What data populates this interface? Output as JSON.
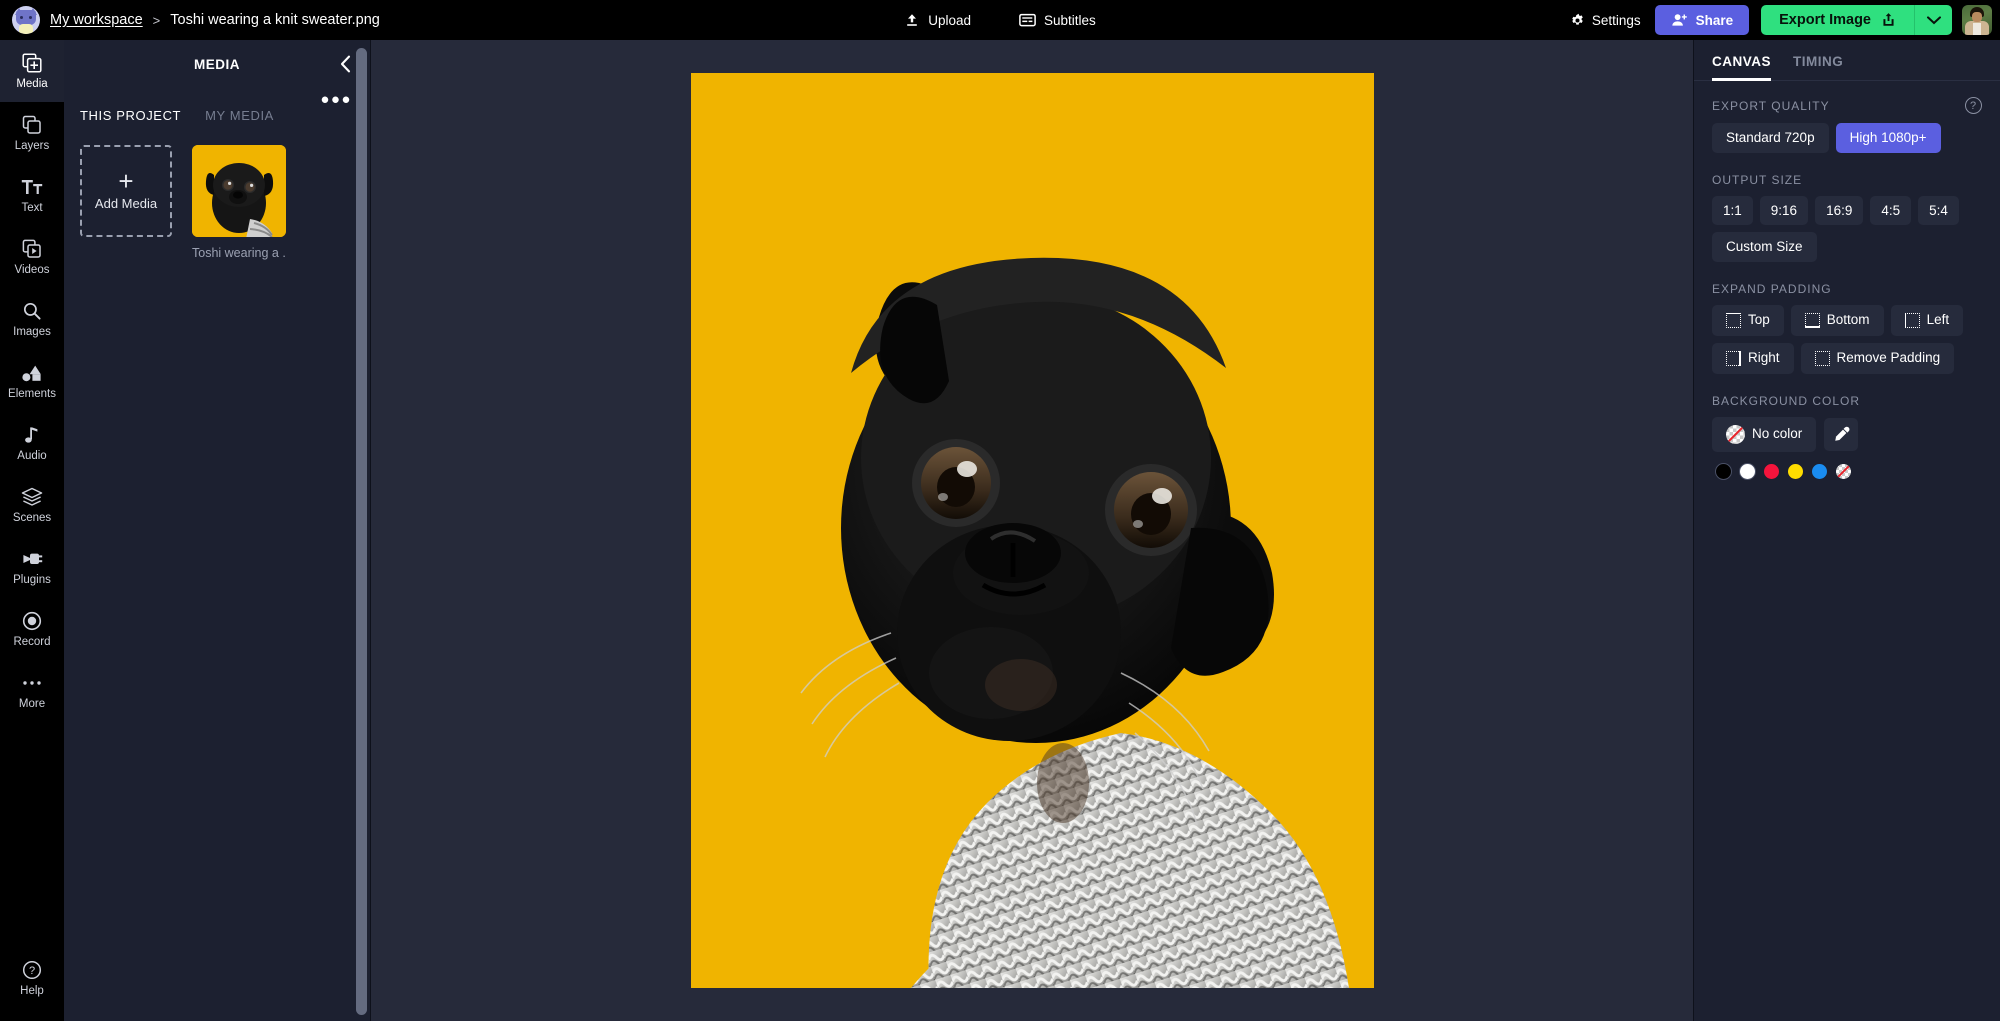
{
  "topbar": {
    "workspace_link": "My workspace",
    "separator": ">",
    "file_name": "Toshi wearing a knit sweater.png",
    "upload_label": "Upload",
    "subtitles_label": "Subtitles",
    "settings_label": "Settings",
    "share_label": "Share",
    "export_label": "Export Image",
    "accent_share": "#5b5fe0",
    "accent_export": "#2fe07f"
  },
  "rail": {
    "items": [
      {
        "label": "Media",
        "icon": "media-icon",
        "active": true
      },
      {
        "label": "Layers",
        "icon": "layers-icon",
        "active": false
      },
      {
        "label": "Text",
        "icon": "text-icon",
        "active": false
      },
      {
        "label": "Videos",
        "icon": "videos-icon",
        "active": false
      },
      {
        "label": "Images",
        "icon": "images-icon",
        "active": false
      },
      {
        "label": "Elements",
        "icon": "elements-icon",
        "active": false
      },
      {
        "label": "Audio",
        "icon": "audio-icon",
        "active": false
      },
      {
        "label": "Scenes",
        "icon": "scenes-icon",
        "active": false
      },
      {
        "label": "Plugins",
        "icon": "plugins-icon",
        "active": false
      },
      {
        "label": "Record",
        "icon": "record-icon",
        "active": false
      },
      {
        "label": "More",
        "icon": "more-icon",
        "active": false
      }
    ],
    "help_label": "Help"
  },
  "media_panel": {
    "title": "MEDIA",
    "tabs": [
      {
        "label": "THIS PROJECT",
        "active": true
      },
      {
        "label": "MY MEDIA",
        "active": false
      }
    ],
    "add_media_label": "Add Media",
    "items": [
      {
        "caption": "Toshi wearing a ...",
        "bg": "#F0B400"
      }
    ]
  },
  "canvas": {
    "background_color": "#F0B400",
    "image_alt": "Black pug wearing a grey knit sweater on yellow background"
  },
  "right_panel": {
    "tabs": [
      {
        "label": "CANVAS",
        "active": true
      },
      {
        "label": "TIMING",
        "active": false
      }
    ],
    "export_quality": {
      "label": "EXPORT QUALITY",
      "options": [
        {
          "label": "Standard 720p",
          "selected": false
        },
        {
          "label": "High 1080p+",
          "selected": true
        }
      ]
    },
    "output_size": {
      "label": "OUTPUT SIZE",
      "options": [
        "1:1",
        "9:16",
        "16:9",
        "4:5",
        "5:4"
      ],
      "custom_label": "Custom Size"
    },
    "expand_padding": {
      "label": "EXPAND PADDING",
      "options": [
        {
          "label": "Top",
          "icon": "padding-top-icon"
        },
        {
          "label": "Bottom",
          "icon": "padding-bottom-icon"
        },
        {
          "label": "Left",
          "icon": "padding-left-icon"
        },
        {
          "label": "Right",
          "icon": "padding-right-icon"
        }
      ],
      "remove_label": "Remove Padding",
      "remove_icon": "padding-remove-icon"
    },
    "background_color": {
      "label": "BACKGROUND COLOR",
      "no_color_label": "No color",
      "eyedropper_icon": "eyedropper-icon",
      "swatches": [
        "#000000",
        "#ffffff",
        "#f5143c",
        "#ffdd00",
        "#1a8cf0",
        "transparent"
      ]
    }
  }
}
